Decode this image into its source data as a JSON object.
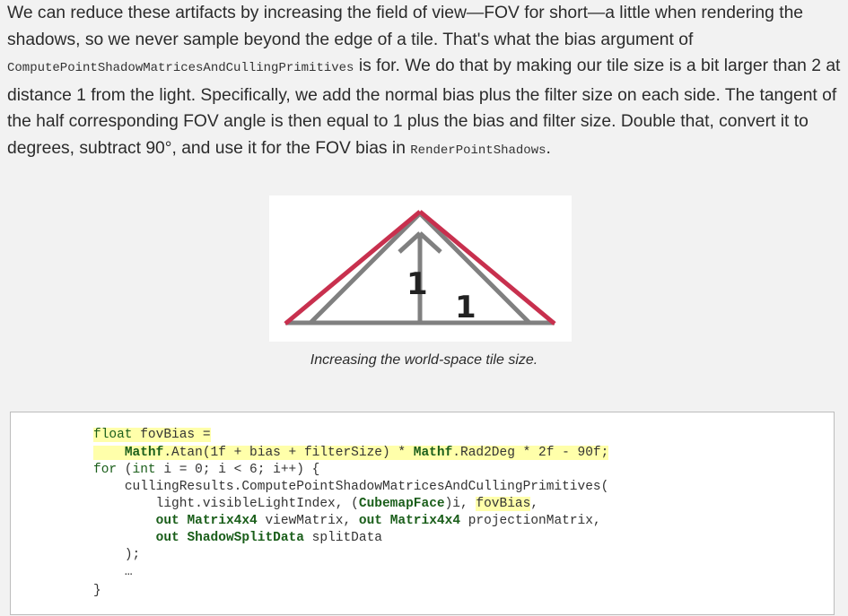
{
  "paragraph": {
    "t1": "We can reduce these artifacts by increasing the field of view—FOV for short—a little when rendering the shadows, so we never sample beyond the edge of a tile. That's what the bias argument of ",
    "code1": "ComputePointShadowMatricesAndCullingPrimitives",
    "t2": " is for. We do that by making our tile size is a bit larger than 2 at distance 1 from the light. Specifically, we add the normal bias plus the filter size on each side. The tangent of the half corresponding FOV angle is then equal to 1 plus the bias and filter size. Double that, convert it to degrees, subtract 90°, and use it for the FOV bias in ",
    "code2": "RenderPointShadows",
    "t3": "."
  },
  "figure": {
    "label_a": "1",
    "label_b": "1",
    "caption": "Increasing the world-space tile size.",
    "colors": {
      "outer": "#c8304e",
      "inner": "#808080"
    }
  },
  "code": {
    "l1_kw": "float",
    "l1_rest": " fovBias =",
    "l2_a": "Mathf",
    "l2_b": ".Atan(1f + bias + filterSize) * ",
    "l2_c": "Mathf",
    "l2_d": ".Rad2Deg * 2f - 90f;",
    "l3_kw": "for",
    "l3_a": " (",
    "l3_kw2": "int",
    "l3_b": " i = 0; i < 6; i++) {",
    "l4": "cullingResults.ComputePointShadowMatricesAndCullingPrimitives(",
    "l5_a": "light.visibleLightIndex, (",
    "l5_ty": "CubemapFace",
    "l5_b": ")i, ",
    "l5_hl": "fovBias",
    "l5_c": ",",
    "l6_kw": "out",
    "l6_ty": "Matrix4x4",
    "l6_a": " viewMatrix, ",
    "l6_kw2": "out",
    "l6_ty2": "Matrix4x4",
    "l6_b": " projectionMatrix,",
    "l7_kw": "out",
    "l7_ty": "ShadowSplitData",
    "l7_a": " splitData",
    "l8": ");",
    "l9": "…",
    "l10": "}"
  }
}
